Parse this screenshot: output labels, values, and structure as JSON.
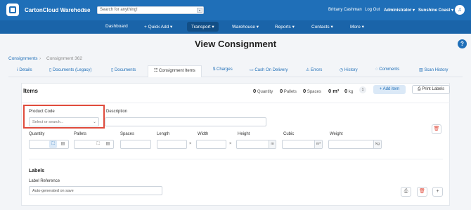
{
  "header": {
    "app_title": "CartonCloud Warehouse",
    "search_placeholder": "Search for anything!",
    "user": "Brittany Cashman",
    "logout": "Log Out",
    "role": "Administrator",
    "site": "Sunshine Coast"
  },
  "nav": {
    "items": [
      "Dashboard",
      "+ Quick Add",
      "Transport",
      "Warehouse",
      "Reports",
      "Contacts",
      "More"
    ]
  },
  "breadcrumb": {
    "root": "Consignments",
    "current": "Consignment 362"
  },
  "page": {
    "title": "View Consignment"
  },
  "tabs": [
    "Details",
    "Documents (Legacy)",
    "Documents",
    "Consignment Items",
    "Charges",
    "Cash On Delivery",
    "Errors",
    "History",
    "Comments",
    "Scan History"
  ],
  "items": {
    "title": "Items",
    "summary": {
      "quantity_value": "0",
      "quantity_label": "Quantity",
      "pallets_value": "0",
      "pallets_label": "Pallets",
      "spaces_value": "0",
      "spaces_label": "Spaces",
      "m3_value": "0 m³",
      "kg_value": "0",
      "kg_label": "kg"
    },
    "count": "1",
    "add_label": "+ Add item",
    "print_label": "Print Labels"
  },
  "item_form": {
    "product_code_label": "Product Code",
    "product_code_placeholder": "Select or search...",
    "description_label": "Description",
    "quantity_label": "Quantity",
    "pallets_label": "Pallets",
    "spaces_label": "Spaces",
    "length_label": "Length",
    "width_label": "Width",
    "height_label": "Height",
    "cubic_label": "Cubic",
    "weight_label": "Weight",
    "length_unit": "m",
    "cubic_unit": "m³",
    "weight_unit": "kg",
    "labels_title": "Labels",
    "label_reference_label": "Label Reference",
    "label_reference_value": "Auto-generated on save"
  }
}
